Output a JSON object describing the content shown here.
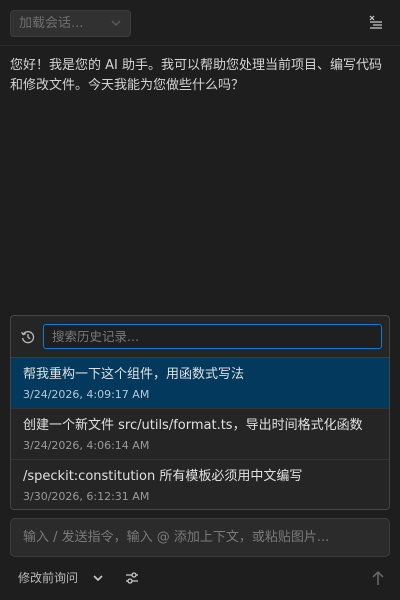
{
  "header": {
    "session_placeholder": "加载会话..."
  },
  "message": {
    "text": "您好！我是您的 AI 助手。我可以帮助您处理当前项目、编写代码和修改文件。今天我能为您做些什么吗？"
  },
  "history": {
    "search_placeholder": "搜索历史记录...",
    "items": [
      {
        "title": "帮我重构一下这个组件，用函数式写法",
        "time": "3/24/2026, 4:09:17 AM"
      },
      {
        "title": "创建一个新文件 src/utils/format.ts，导出时间格式化函数",
        "time": "3/24/2026, 4:06:14 AM"
      },
      {
        "title": "/speckit:constitution 所有模板必须用中文编写",
        "time": "3/30/2026, 6:12:31 AM"
      }
    ]
  },
  "composer": {
    "placeholder": "输入 / 发送指令，输入 @ 添加上下文，或粘贴图片...",
    "mode_label": "修改前询问"
  },
  "icons": {
    "session_dropdown": "chevron-down-icon",
    "clear": "clear-all-icon",
    "history": "history-icon",
    "mode_dropdown": "chevron-down-icon",
    "settings": "sliders-icon",
    "send": "arrow-up-icon"
  },
  "colors": {
    "background": "#1e1e1e",
    "selected_item": "#04395e",
    "focus_border": "#0e7bd4"
  }
}
